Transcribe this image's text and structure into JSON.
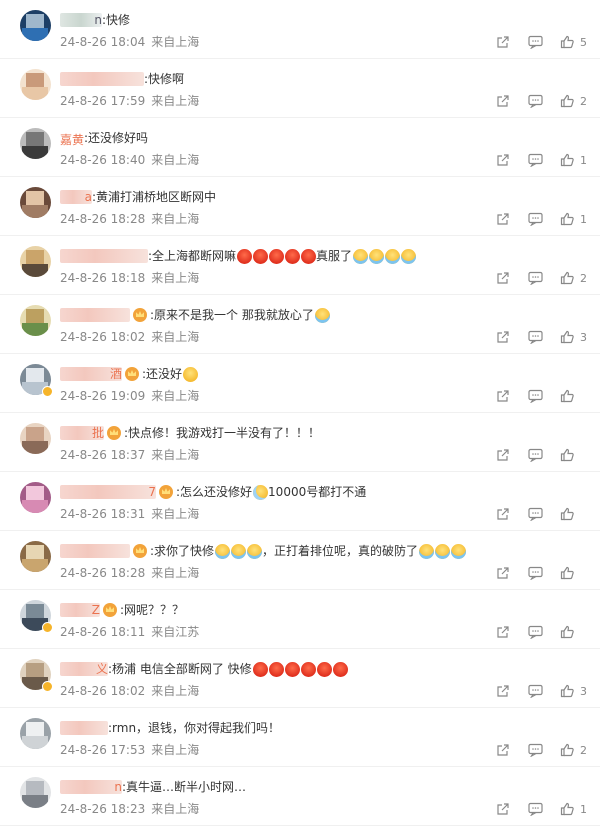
{
  "meta": {
    "from_prefix": "来自",
    "icons": [
      "share-icon",
      "comment-icon",
      "like-icon"
    ]
  },
  "comments": [
    {
      "name_suffix": "n",
      "text": ":快修",
      "emojis": [],
      "date": "24-8-26 18:04",
      "location": "来自上海",
      "likes": "5",
      "badge": "",
      "crown": false,
      "name_style": "gray"
    },
    {
      "name_suffix": "",
      "text": ":快修啊",
      "emojis": [],
      "date": "24-8-26 17:59",
      "location": "来自上海",
      "likes": "2",
      "badge": "",
      "crown": false,
      "name_style": "pink"
    },
    {
      "name_suffix": "嘉黄",
      "text": ":还没修好吗",
      "emojis": [],
      "date": "24-8-26 18:40",
      "location": "来自上海",
      "likes": "1",
      "badge": "",
      "crown": false,
      "name_style": "plainred"
    },
    {
      "name_suffix": "a",
      "text": ":黄浦打浦桥地区断网中",
      "emojis": [],
      "date": "24-8-26 18:28",
      "location": "来自上海",
      "likes": "1",
      "badge": "",
      "crown": false,
      "name_style": "pink"
    },
    {
      "name_suffix": "",
      "text": ":全上海都断网嘛",
      "emojis": [
        "angry",
        "angry",
        "angry",
        "angry",
        "angry"
      ],
      "text2": "真服了",
      "emojis2": [
        "cry",
        "cry",
        "cry",
        "cry"
      ],
      "date": "24-8-26 18:18",
      "location": "来自上海",
      "likes": "2",
      "badge": "",
      "crown": false,
      "name_style": "pink"
    },
    {
      "name_suffix": "",
      "text": ":原来不是我一个 那我就放心了",
      "emojis": [],
      "emojis2": [
        "cry"
      ],
      "date": "24-8-26 18:02",
      "location": "来自上海",
      "likes": "3",
      "badge": "",
      "crown": true,
      "name_style": "pink"
    },
    {
      "name_suffix": "酒",
      "text": ":还没好",
      "emojis": [],
      "emojis2": [
        "plain"
      ],
      "date": "24-8-26 19:09",
      "location": "来自上海",
      "likes": "",
      "badge": "vip",
      "crown": true,
      "name_style": "pink"
    },
    {
      "name_suffix": "批",
      "text": ":快点修！我游戏打一半没有了！！！",
      "emojis": [],
      "date": "24-8-26 18:37",
      "location": "来自上海",
      "likes": "",
      "badge": "",
      "crown": true,
      "name_style": "pink"
    },
    {
      "name_suffix": "7",
      "text": ":怎么还没修好",
      "emojis": [
        "sweat"
      ],
      "text2": "10000号都打不通",
      "date": "24-8-26 18:31",
      "location": "来自上海",
      "likes": "",
      "badge": "",
      "crown": true,
      "name_style": "pink"
    },
    {
      "name_suffix": "",
      "text": ":求你了快修",
      "emojis": [
        "cry",
        "cry",
        "cry"
      ],
      "text2": "，正打着排位呢，真的破防了",
      "emojis2": [
        "cry",
        "cry",
        "cry"
      ],
      "date": "24-8-26 18:28",
      "location": "来自上海",
      "likes": "",
      "badge": "",
      "crown": true,
      "name_style": "pink"
    },
    {
      "name_suffix": "Z",
      "text": ":网呢？？？",
      "emojis": [],
      "date": "24-8-26 18:11",
      "location": "来自江苏",
      "likes": "",
      "badge": "vip",
      "crown": true,
      "name_style": "pink"
    },
    {
      "name_suffix": "义",
      "text": ":杨浦  电信全部断网了  快修",
      "emojis": [
        "angry",
        "angry",
        "angry",
        "angry",
        "angry",
        "angry"
      ],
      "date": "24-8-26 18:02",
      "location": "来自上海",
      "likes": "3",
      "badge": "vip",
      "crown": false,
      "name_style": "pink"
    },
    {
      "name_suffix": "",
      "text": ":rmn，退钱，你对得起我们吗！",
      "emojis": [],
      "date": "24-8-26 17:53",
      "location": "来自上海",
      "likes": "2",
      "badge": "",
      "crown": false,
      "name_style": "pink"
    },
    {
      "name_suffix": "n",
      "text": ":真牛逼…断半小时网…",
      "emojis": [],
      "date": "24-8-26 18:23",
      "location": "来自上海",
      "likes": "1",
      "badge": "",
      "crown": false,
      "name_style": "pink"
    }
  ]
}
